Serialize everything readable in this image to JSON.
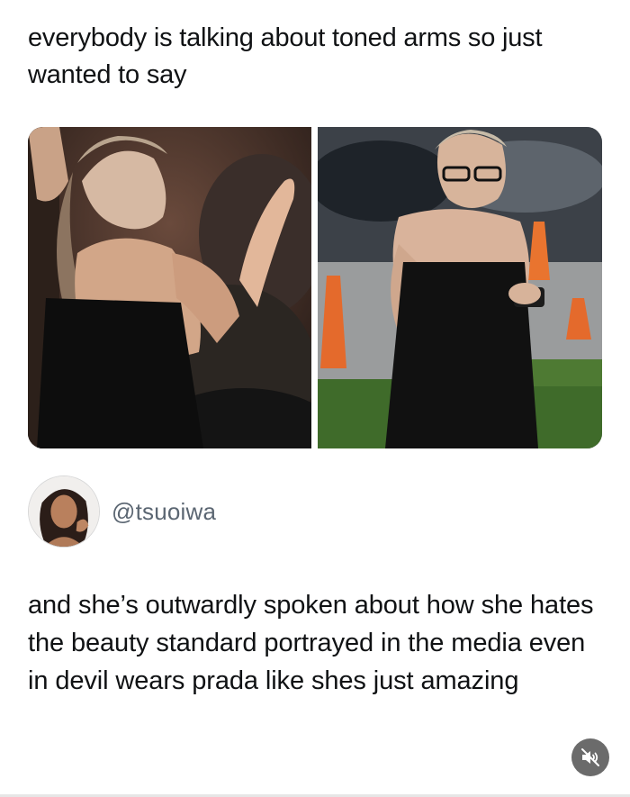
{
  "post": {
    "headline": "everybody is talking about toned arms so just wanted to say",
    "body": "and she’s outwardly spoken about how she hates the beauty standard portrayed in the media even in devil wears prada like shes just amazing"
  },
  "author": {
    "handle": "@tsuoiwa"
  },
  "media": {
    "images": [
      "woman-clapping-in-audience-photo",
      "woman-in-strapless-dress-outdoors-photo"
    ]
  },
  "controls": {
    "mute_icon": "speaker-muted-icon"
  },
  "colors": {
    "text": "#101214",
    "handle": "#5b6672",
    "mute_button": "#6b6b6b"
  }
}
